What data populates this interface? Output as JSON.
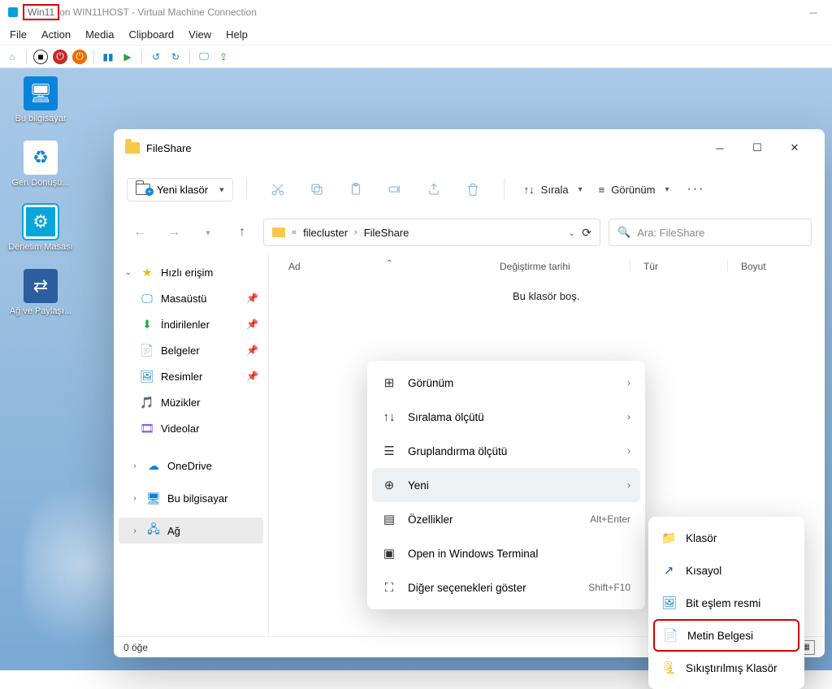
{
  "host": {
    "title_highlight": "Win11",
    "title_rest": " on WIN11HOST - Virtual Machine Connection",
    "menu": [
      "File",
      "Action",
      "Media",
      "Clipboard",
      "View",
      "Help"
    ]
  },
  "desktop_icons": {
    "this_pc": "Bu bilgisayar",
    "recycle": "Geri Dönüşü...",
    "control": "Denetim Masası",
    "network": "Ağ ve Paylaşı..."
  },
  "explorer": {
    "title": "FileShare",
    "newfolder": "Yeni klasör",
    "sort": "Sırala",
    "view": "Görünüm",
    "address": {
      "ellipsis": "«",
      "part1": "filecluster",
      "part2": "FileShare"
    },
    "search_prefix": "Ara: ",
    "search_scope": "FileShare",
    "sidebar": {
      "quick": "Hızlı erişim",
      "desktop": "Masaüstü",
      "downloads": "İndirilenler",
      "documents": "Belgeler",
      "pictures": "Resimler",
      "music": "Müzikler",
      "videos": "Videolar",
      "onedrive": "OneDrive",
      "thispc": "Bu bilgisayar",
      "network": "Ağ"
    },
    "columns": {
      "name": "Ad",
      "modified": "Değiştirme tarihi",
      "type": "Tür",
      "size": "Boyut"
    },
    "empty": "Bu klasör boş.",
    "status": "0 öğe"
  },
  "ctx": {
    "view": "Görünüm",
    "sort": "Sıralama ölçütü",
    "group": "Gruplandırma ölçütü",
    "new": "Yeni",
    "properties": "Özellikler",
    "properties_accel": "Alt+Enter",
    "terminal": "Open in Windows Terminal",
    "more": "Diğer seçenekleri göster",
    "more_accel": "Shift+F10"
  },
  "subctx": {
    "folder": "Klasör",
    "shortcut": "Kısayol",
    "bitmap": "Bit eşlem resmi",
    "text": "Metin Belgesi",
    "zip": "Sıkıştırılmış Klasör"
  }
}
